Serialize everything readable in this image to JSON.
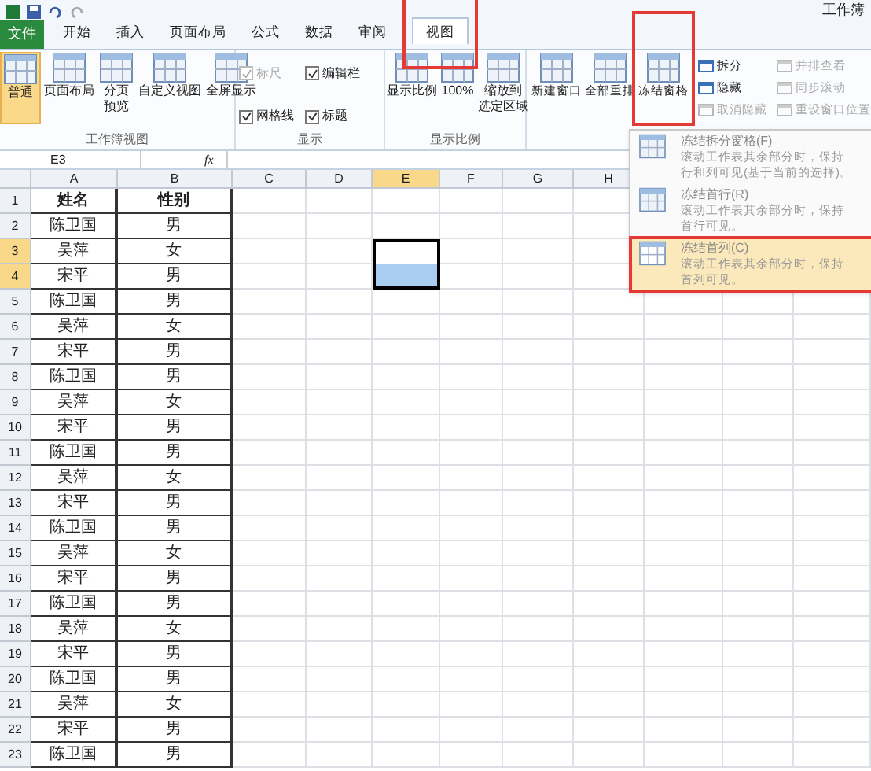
{
  "window": {
    "title": "工作簿"
  },
  "tabs": [
    {
      "label": "文件",
      "kind": "file",
      "selected": false
    },
    {
      "label": "开始",
      "kind": "tab",
      "selected": false
    },
    {
      "label": "插入",
      "kind": "tab",
      "selected": false
    },
    {
      "label": "页面布局",
      "kind": "tab",
      "selected": false
    },
    {
      "label": "公式",
      "kind": "tab",
      "selected": false
    },
    {
      "label": "数据",
      "kind": "tab",
      "selected": false
    },
    {
      "label": "审阅",
      "kind": "tab",
      "selected": false
    },
    {
      "label": "视图",
      "kind": "tab",
      "selected": true
    }
  ],
  "ribbon": {
    "workbook_views": {
      "label": "工作簿视图",
      "buttons": [
        {
          "lines": [
            "普通"
          ],
          "selected": true
        },
        {
          "lines": [
            "页面布局"
          ],
          "selected": false
        },
        {
          "lines": [
            "分页",
            "预览"
          ],
          "selected": false
        },
        {
          "lines": [
            "自定义视图"
          ],
          "selected": false
        },
        {
          "lines": [
            "全屏显示"
          ],
          "selected": false
        }
      ]
    },
    "show": {
      "label": "显示",
      "checks": [
        {
          "label": "标尺",
          "checked": true,
          "disabled": true
        },
        {
          "label": "编辑栏",
          "checked": true,
          "disabled": false
        },
        {
          "label": "网格线",
          "checked": true,
          "disabled": false
        },
        {
          "label": "标题",
          "checked": true,
          "disabled": false
        }
      ]
    },
    "zoom": {
      "label": "显示比例",
      "buttons": [
        {
          "lines": [
            "显示比例"
          ]
        },
        {
          "lines": [
            "100%"
          ]
        },
        {
          "lines": [
            "缩放到",
            "选定区域"
          ]
        }
      ]
    },
    "window": {
      "big_buttons": [
        "新建窗口",
        "全部重排",
        "冻结窗格"
      ],
      "small_buttons": [
        {
          "label": "拆分",
          "disabled": false
        },
        {
          "label": "隐藏",
          "disabled": false
        },
        {
          "label": "取消隐藏",
          "disabled": true
        }
      ],
      "side_buttons": [
        {
          "label": "并排查看",
          "disabled": true
        },
        {
          "label": "同步滚动",
          "disabled": true
        },
        {
          "label": "重设窗口位置",
          "disabled": true
        }
      ]
    }
  },
  "formula_bar": {
    "name_box": "E3",
    "fx": "fx"
  },
  "columns": [
    "A",
    "B",
    "C",
    "D",
    "E",
    "F",
    "G",
    "H"
  ],
  "rows": [
    {
      "number": "1",
      "a": "姓名",
      "b": "性别",
      "header": true
    },
    {
      "number": "2",
      "a": "陈卫国",
      "b": "男",
      "header": false
    },
    {
      "number": "3",
      "a": "吴萍",
      "b": "女",
      "header": false
    },
    {
      "number": "4",
      "a": "宋平",
      "b": "男",
      "header": false
    },
    {
      "number": "5",
      "a": "陈卫国",
      "b": "男",
      "header": false
    },
    {
      "number": "6",
      "a": "吴萍",
      "b": "女",
      "header": false
    },
    {
      "number": "7",
      "a": "宋平",
      "b": "男",
      "header": false
    },
    {
      "number": "8",
      "a": "陈卫国",
      "b": "男",
      "header": false
    },
    {
      "number": "9",
      "a": "吴萍",
      "b": "女",
      "header": false
    },
    {
      "number": "10",
      "a": "宋平",
      "b": "男",
      "header": false
    },
    {
      "number": "11",
      "a": "陈卫国",
      "b": "男",
      "header": false
    },
    {
      "number": "12",
      "a": "吴萍",
      "b": "女",
      "header": false
    },
    {
      "number": "13",
      "a": "宋平",
      "b": "男",
      "header": false
    },
    {
      "number": "14",
      "a": "陈卫国",
      "b": "男",
      "header": false
    },
    {
      "number": "15",
      "a": "吴萍",
      "b": "女",
      "header": false
    },
    {
      "number": "16",
      "a": "宋平",
      "b": "男",
      "header": false
    },
    {
      "number": "17",
      "a": "陈卫国",
      "b": "男",
      "header": false
    },
    {
      "number": "18",
      "a": "吴萍",
      "b": "女",
      "header": false
    },
    {
      "number": "19",
      "a": "宋平",
      "b": "男",
      "header": false
    },
    {
      "number": "20",
      "a": "陈卫国",
      "b": "男",
      "header": false
    },
    {
      "number": "21",
      "a": "吴萍",
      "b": "女",
      "header": false
    },
    {
      "number": "22",
      "a": "宋平",
      "b": "男",
      "header": false
    },
    {
      "number": "23",
      "a": "陈卫国",
      "b": "男",
      "header": false
    }
  ],
  "freeze_menu": [
    {
      "title": "冻结拆分窗格(F)",
      "lines": [
        "滚动工作表其余部分时，保持",
        "行和列可见(基于当前的选择)。"
      ],
      "selected": false
    },
    {
      "title": "冻结首行(R)",
      "lines": [
        "滚动工作表其余部分时，保持",
        "首行可见。"
      ],
      "selected": false
    },
    {
      "title": "冻结首列(C)",
      "lines": [
        "滚动工作表其余部分时，保持",
        "首列可见。"
      ],
      "selected": true
    }
  ]
}
